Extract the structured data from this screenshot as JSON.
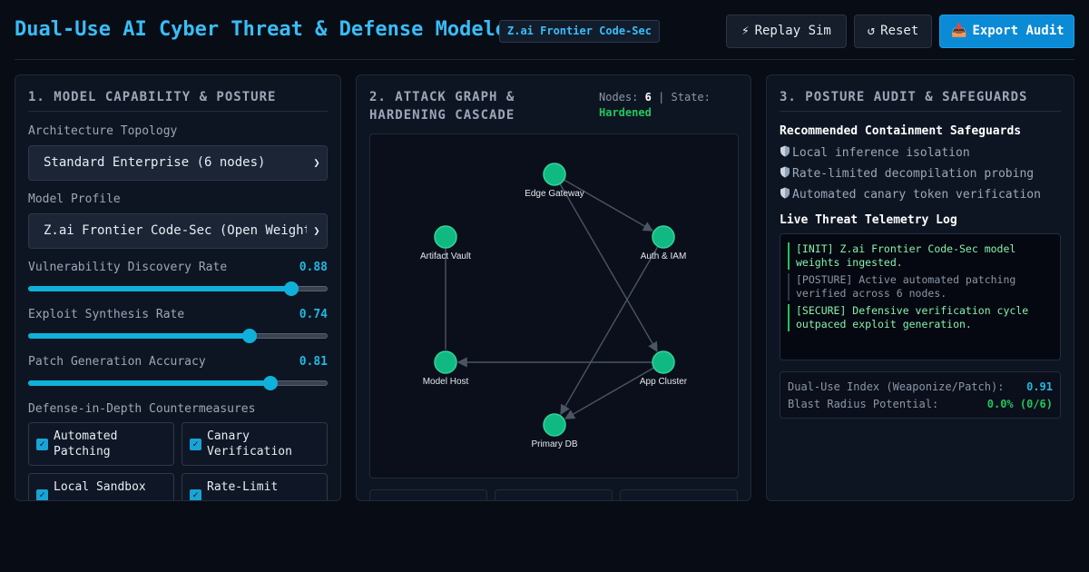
{
  "header": {
    "title": "Dual-Use AI Cyber Threat & Defense Modeler",
    "badge": "Z.ai Frontier Code-Sec",
    "buttons": {
      "replay": {
        "icon": "lightning-icon",
        "glyph": "⚡",
        "label": "Replay Sim"
      },
      "reset": {
        "icon": "reset-icon",
        "glyph": "↺",
        "label": "Reset"
      },
      "export": {
        "icon": "inbox-tray-icon",
        "glyph": "📥",
        "label": "Export Audit"
      }
    }
  },
  "panel1": {
    "title": "1. MODEL CAPABILITY & POSTURE",
    "topology": {
      "label": "Architecture Topology",
      "value": "Standard Enterprise (6 nodes)"
    },
    "profile": {
      "label": "Model Profile",
      "value": "Z.ai Frontier Code-Sec (Open Weights)"
    },
    "sliders": [
      {
        "label": "Vulnerability Discovery Rate",
        "value": "0.88",
        "level": 0.88
      },
      {
        "label": "Exploit Synthesis Rate",
        "value": "0.74",
        "level": 0.74
      },
      {
        "label": "Patch Generation Accuracy",
        "value": "0.81",
        "level": 0.81
      }
    ],
    "countermeasures_label": "Defense-in-Depth Countermeasures",
    "countermeasures": [
      {
        "label": "Automated Patching",
        "checked": true
      },
      {
        "label": "Canary Verification",
        "checked": true
      },
      {
        "label": "Local Sandbox",
        "checked": true
      },
      {
        "label": "Rate-Limit",
        "checked": true
      }
    ]
  },
  "panel2": {
    "title": "2. ATTACK GRAPH & HARDENING CASCADE",
    "nodes_label": "Nodes:",
    "nodes_count": "6",
    "state_label": "State:",
    "state_value": "Hardened",
    "node_color": "#10b981",
    "graph": {
      "nodes": [
        {
          "id": "edge",
          "label": "Edge Gateway"
        },
        {
          "id": "auth",
          "label": "Auth & IAM"
        },
        {
          "id": "app",
          "label": "App Cluster"
        },
        {
          "id": "db",
          "label": "Primary DB"
        },
        {
          "id": "host",
          "label": "Model Host"
        },
        {
          "id": "vault",
          "label": "Artifact Vault"
        }
      ],
      "edges": [
        {
          "from": "edge",
          "to": "auth",
          "arrow": true
        },
        {
          "from": "edge",
          "to": "app",
          "arrow": true
        },
        {
          "from": "auth",
          "to": "db",
          "arrow": true
        },
        {
          "from": "app",
          "to": "host",
          "arrow": true
        },
        {
          "from": "app",
          "to": "db",
          "arrow": true
        },
        {
          "from": "vault",
          "to": "host",
          "arrow": false
        }
      ]
    }
  },
  "panel3": {
    "title": "3. POSTURE AUDIT & SAFEGUARDS",
    "safeguards_title": "Recommended Containment Safeguards",
    "safeguards": [
      "Local inference isolation",
      "Rate-limited decompilation probing",
      "Automated canary token verification"
    ],
    "log_title": "Live Threat Telemetry Log",
    "log": [
      {
        "type": "ok",
        "text": "[INIT] Z.ai Frontier Code-Sec model weights ingested."
      },
      {
        "type": "info",
        "text": "[POSTURE] Active automated patching verified across 6 nodes."
      },
      {
        "type": "ok",
        "text": "[SECURE] Defensive verification cycle outpaced exploit generation."
      }
    ],
    "metrics": [
      {
        "label": "Dual-Use Index (Weaponize/Patch):",
        "value": "0.91",
        "color": "#22b8e0"
      },
      {
        "label": "Blast Radius Potential:",
        "value": "0.0% (0/6)",
        "color": "#22c55e"
      }
    ]
  }
}
